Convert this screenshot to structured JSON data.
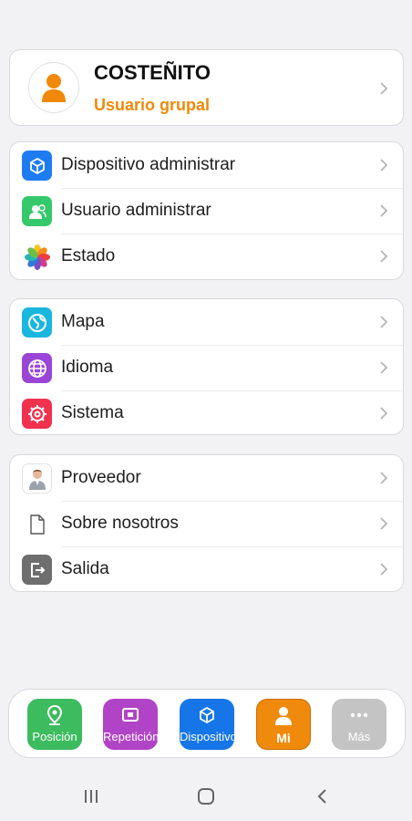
{
  "profile": {
    "name": "COSTEÑITO",
    "role": "Usuario grupal",
    "role_color": "#f0890a"
  },
  "menu_groups": [
    {
      "items": [
        {
          "label": "Dispositivo administrar",
          "icon": "cube-icon",
          "color": "#1e7cf2"
        },
        {
          "label": "Usuario administrar",
          "icon": "users-icon",
          "color": "#36c96b"
        },
        {
          "label": "Estado",
          "icon": "pinwheel-icon",
          "color": "#ffffff"
        }
      ]
    },
    {
      "items": [
        {
          "label": "Mapa",
          "icon": "globe-icon",
          "color": "#19b6e0"
        },
        {
          "label": "Idioma",
          "icon": "language-globe-icon",
          "color": "#9a45d6"
        },
        {
          "label": "Sistema",
          "icon": "settings-icon",
          "color": "#f0324e"
        }
      ]
    },
    {
      "items": [
        {
          "label": "Proveedor",
          "icon": "provider-person-icon",
          "color": "#ffffff"
        },
        {
          "label": "Sobre nosotros",
          "icon": "document-icon",
          "color": "#ffffff"
        },
        {
          "label": "Salida",
          "icon": "exit-icon",
          "color": "#6e6e6e"
        }
      ]
    }
  ],
  "tabbar": {
    "tabs": [
      {
        "label": "Posición",
        "icon": "location-pin-icon",
        "color": "#3dbb5f"
      },
      {
        "label": "Repetición",
        "icon": "playback-icon",
        "color": "#b144c6"
      },
      {
        "label": "Dispositivo",
        "icon": "cube-icon",
        "color": "#1676e8"
      },
      {
        "label": "Mi",
        "icon": "person-icon",
        "color": "#f08a0c",
        "active": true
      },
      {
        "label": "Más",
        "icon": "more-icon",
        "color": "#c4c4c4"
      }
    ]
  },
  "system_nav": {
    "buttons": [
      "recents-icon",
      "home-icon",
      "back-icon"
    ]
  }
}
